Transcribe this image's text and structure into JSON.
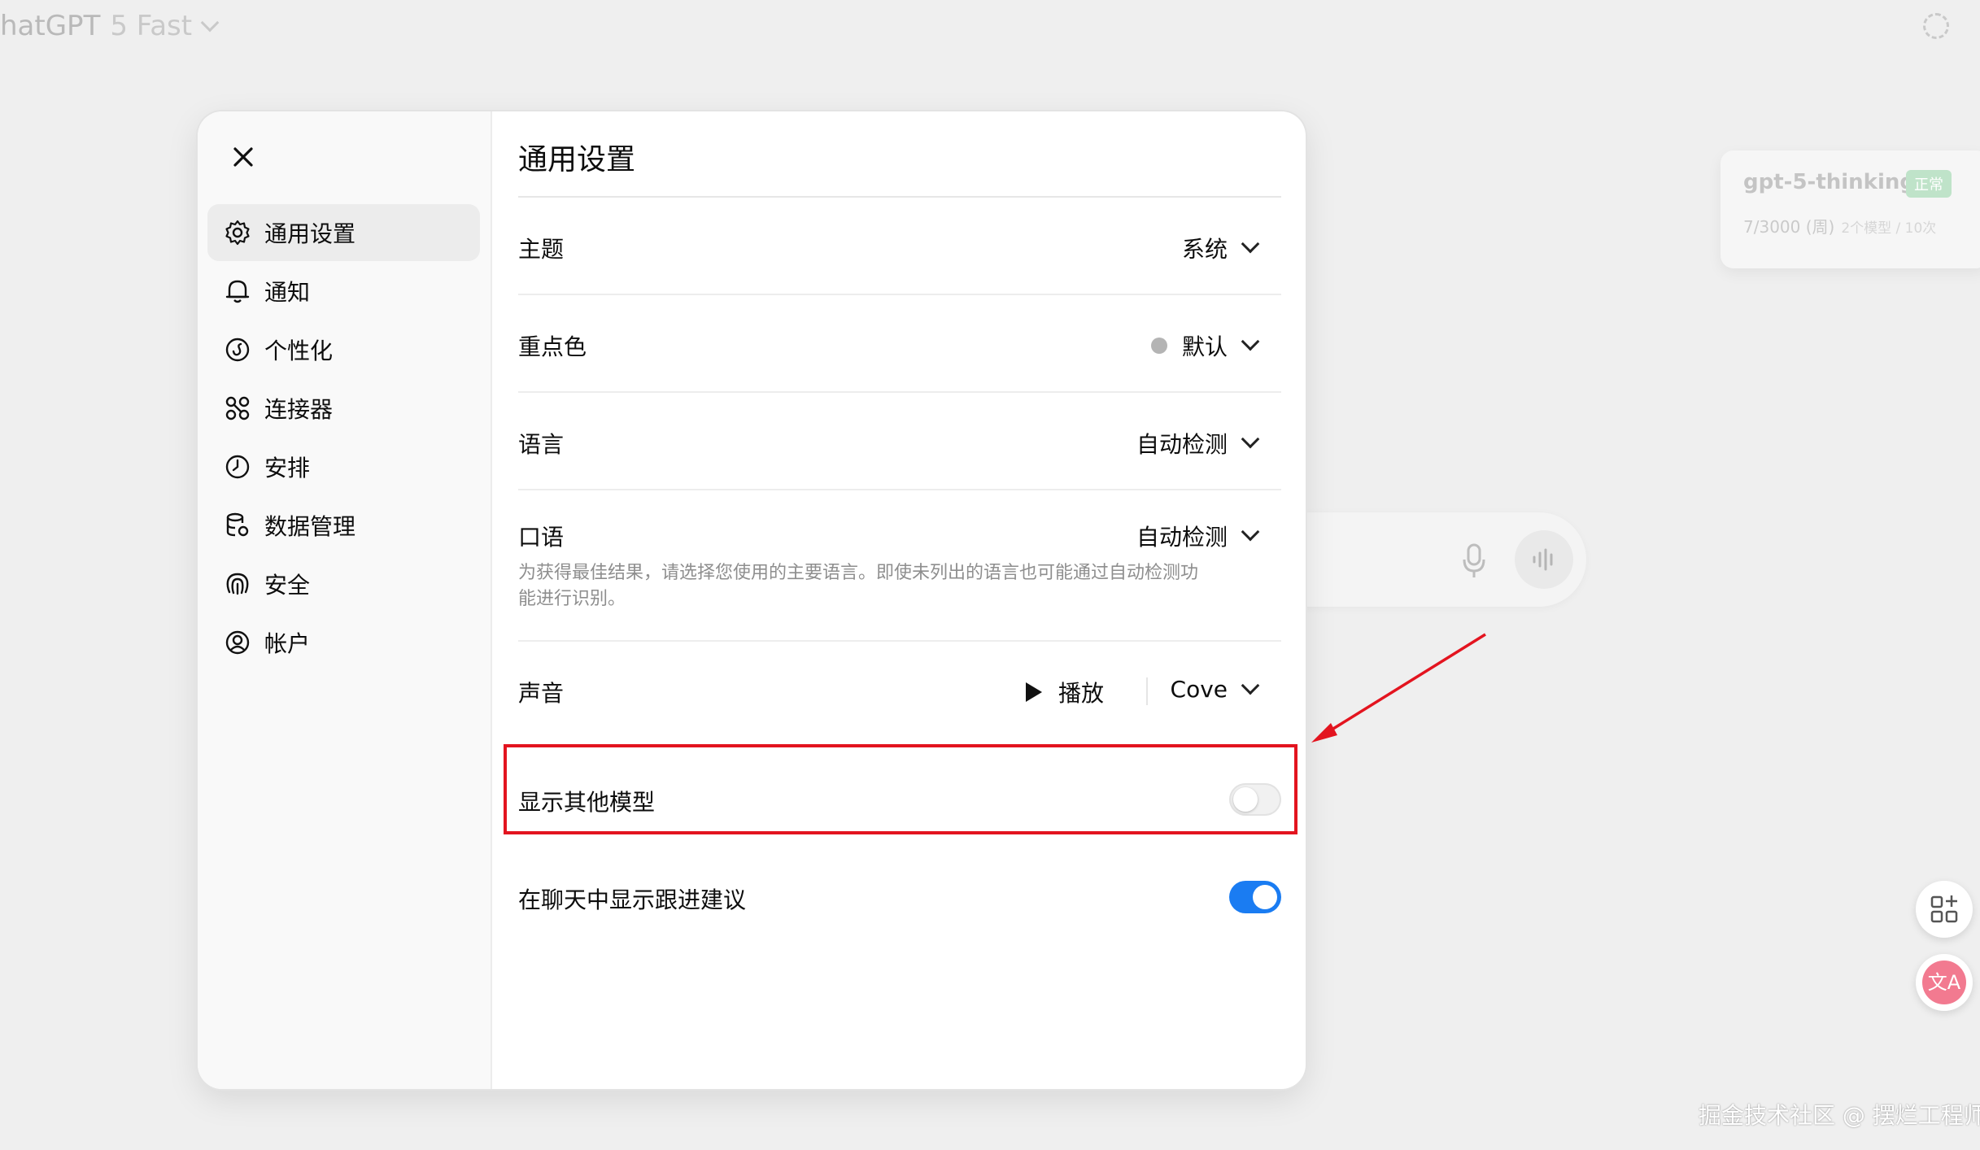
{
  "app": {
    "title": "hatGPT",
    "model": "5 Fast"
  },
  "status_card": {
    "model_name": "gpt-5-thinking",
    "badge": "正常",
    "quota": "7/3000 (周)",
    "quota_detail": "2个模型 / 10次"
  },
  "dialog": {
    "close_icon": "close-icon",
    "title": "通用设置",
    "sidebar": {
      "items": [
        {
          "label": "通用设置",
          "icon": "gear-icon",
          "active": true
        },
        {
          "label": "通知",
          "icon": "bell-icon",
          "active": false
        },
        {
          "label": "个性化",
          "icon": "personalization-icon",
          "active": false
        },
        {
          "label": "连接器",
          "icon": "connectors-icon",
          "active": false
        },
        {
          "label": "安排",
          "icon": "clock-icon",
          "active": false
        },
        {
          "label": "数据管理",
          "icon": "database-icon",
          "active": false
        },
        {
          "label": "安全",
          "icon": "fingerprint-icon",
          "active": false
        },
        {
          "label": "帐户",
          "icon": "user-circle-icon",
          "active": false
        }
      ]
    },
    "settings": {
      "theme": {
        "label": "主题",
        "value": "系统"
      },
      "accent": {
        "label": "重点色",
        "value": "默认",
        "dot_color": "#b4b4b4"
      },
      "language": {
        "label": "语言",
        "value": "自动检测"
      },
      "spoken": {
        "label": "口语",
        "value": "自动检测",
        "hint": "为获得最佳结果，请选择您使用的主要语言。即使未列出的语言也可能通过自动检测功能进行识别。"
      },
      "voice": {
        "label": "声音",
        "play_label": "播放",
        "value": "Cove"
      },
      "show_other_models": {
        "label": "显示其他模型",
        "enabled": false
      },
      "follow_up": {
        "label": "在聊天中显示跟进建议",
        "enabled": true
      }
    }
  },
  "watermark": "掘金技术社区 @ 摆烂工程师",
  "colors": {
    "toggle_on": "#1a7cf2",
    "highlight": "#e3141f"
  }
}
